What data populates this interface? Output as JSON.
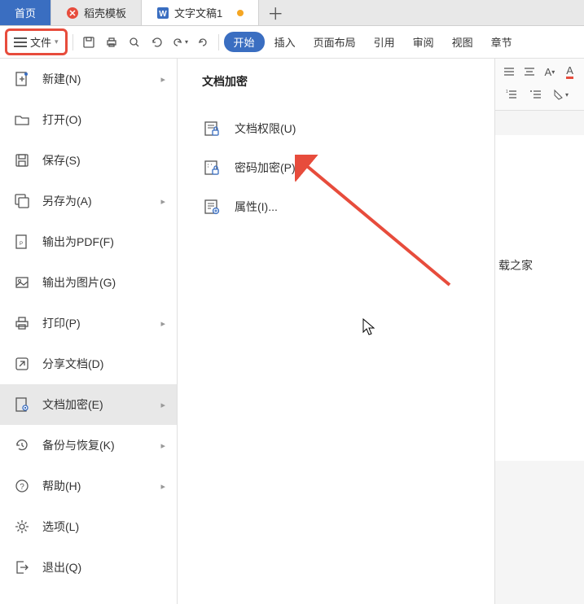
{
  "tabs": {
    "home": "首页",
    "templates": "稻壳模板",
    "doc": "文字文稿1"
  },
  "toolbar": {
    "file_label": "文件"
  },
  "ribbon": {
    "tabs": [
      "开始",
      "插入",
      "页面布局",
      "引用",
      "审阅",
      "视图",
      "章节"
    ]
  },
  "file_menu": {
    "items": [
      {
        "label": "新建(N)",
        "icon": "new",
        "has_arrow": true
      },
      {
        "label": "打开(O)",
        "icon": "open",
        "has_arrow": false
      },
      {
        "label": "保存(S)",
        "icon": "save",
        "has_arrow": false
      },
      {
        "label": "另存为(A)",
        "icon": "saveas",
        "has_arrow": true
      },
      {
        "label": "输出为PDF(F)",
        "icon": "pdf",
        "has_arrow": false
      },
      {
        "label": "输出为图片(G)",
        "icon": "image",
        "has_arrow": false
      },
      {
        "label": "打印(P)",
        "icon": "print",
        "has_arrow": true
      },
      {
        "label": "分享文档(D)",
        "icon": "share",
        "has_arrow": false
      },
      {
        "label": "文档加密(E)",
        "icon": "encrypt",
        "has_arrow": true,
        "selected": true
      },
      {
        "label": "备份与恢复(K)",
        "icon": "backup",
        "has_arrow": true
      },
      {
        "label": "帮助(H)",
        "icon": "help",
        "has_arrow": true
      },
      {
        "label": "选项(L)",
        "icon": "options",
        "has_arrow": false
      },
      {
        "label": "退出(Q)",
        "icon": "exit",
        "has_arrow": false
      }
    ]
  },
  "submenu": {
    "title": "文档加密",
    "items": [
      {
        "label": "文档权限(U)",
        "icon": "permissions"
      },
      {
        "label": "密码加密(P)",
        "icon": "password"
      },
      {
        "label": "属性(I)...",
        "icon": "properties"
      }
    ]
  },
  "doc_content": "载之家",
  "annotation": {
    "color": "#e74c3c"
  }
}
